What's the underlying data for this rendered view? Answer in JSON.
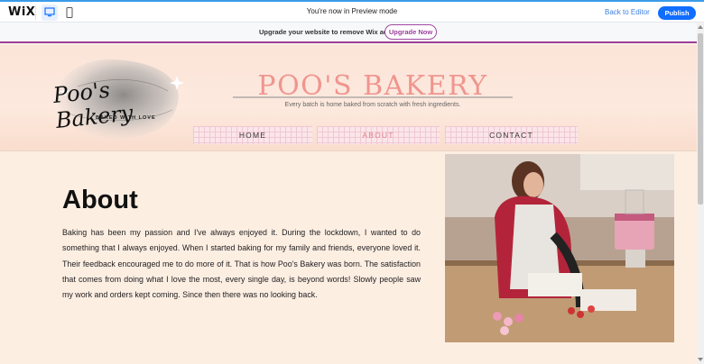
{
  "wix_bar": {
    "logo": "WiX",
    "mode_text": "You're now in Preview mode",
    "back_label": "Back to Editor",
    "publish_label": "Publish",
    "devices": [
      "desktop-icon",
      "mobile-icon"
    ]
  },
  "upgrade_banner": {
    "text": "Upgrade your website to remove Wix ads",
    "button_label": "Upgrade Now"
  },
  "site": {
    "logo": {
      "script": "Poo's Bakery",
      "tagline": "BAKED WITH LOVE"
    },
    "brand": "POO'S BAKERY",
    "tagline": "Every batch is home baked from scratch with fresh ingredients.",
    "nav": [
      {
        "label": "HOME",
        "active": false
      },
      {
        "label": "ABOUT",
        "active": true
      },
      {
        "label": "CONTACT",
        "active": false
      }
    ]
  },
  "about": {
    "title": "About",
    "body": "Baking has been my passion and I've always enjoyed it. During the lockdown, I wanted to do something that I always enjoyed. When I started baking for my family and friends, everyone loved it. Their feedback encouraged me to do more of it. That is how Poo's Bakery was born. The satisfaction that comes from doing what I love the most, every single day, is beyond words! Slowly people saw my work and orders kept coming. Since then there was no looking back."
  },
  "colors": {
    "accent_blue": "#116dff",
    "upgrade_purple": "#9b3f9b",
    "brand_pink": "#f0958f",
    "page_bg": "#fdeee2"
  }
}
